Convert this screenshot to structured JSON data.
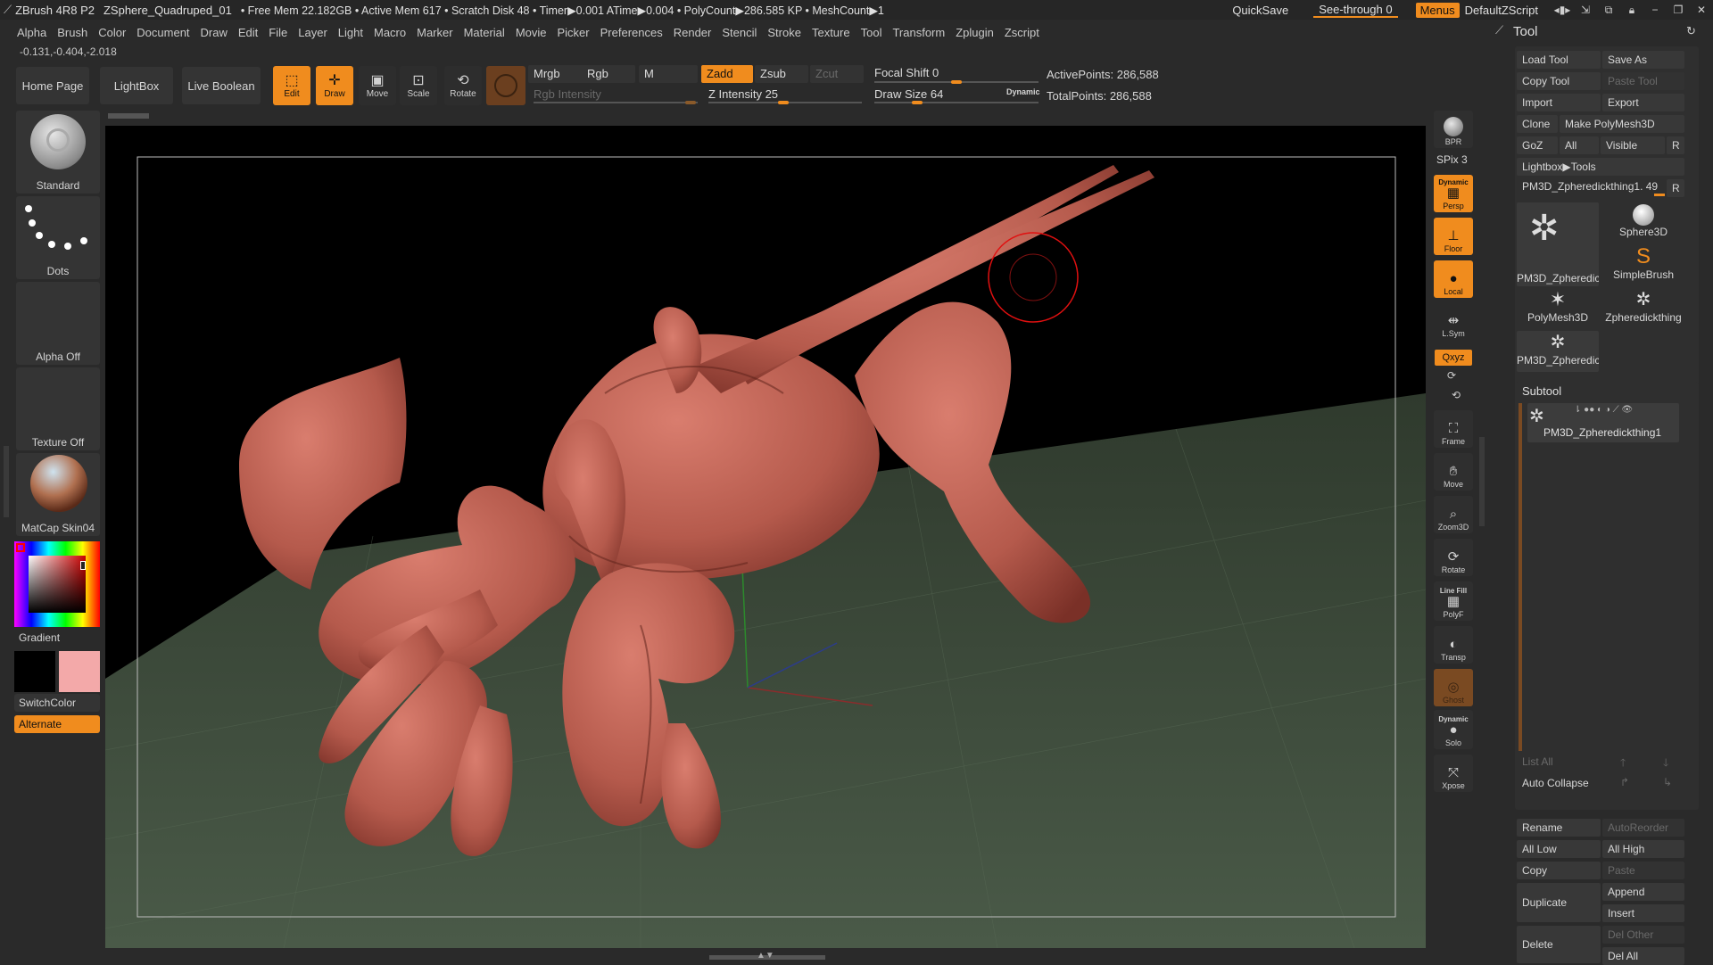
{
  "titlebar": {
    "app": "ZBrush 4R8 P2",
    "document": "ZSphere_Quadruped_01",
    "status": "• Free Mem 22.182GB • Active Mem 617 • Scratch Disk 48 •  Timer▶0.001 ATime▶0.004 • PolyCount▶286.585 KP  • MeshCount▶1",
    "quicksave": "QuickSave",
    "seethrough": "See-through  0",
    "menus": "Menus",
    "script": "DefaultZScript"
  },
  "menubar": [
    "Alpha",
    "Brush",
    "Color",
    "Document",
    "Draw",
    "Edit",
    "File",
    "Layer",
    "Light",
    "Macro",
    "Marker",
    "Material",
    "Movie",
    "Picker",
    "Preferences",
    "Render",
    "Stencil",
    "Stroke",
    "Texture",
    "Tool",
    "Transform",
    "Zplugin",
    "Zscript"
  ],
  "coords": "-0.131,-0.404,-2.018",
  "shelf": {
    "home": "Home Page",
    "lightbox": "LightBox",
    "liveboolean": "Live Boolean",
    "edit": "Edit",
    "draw": "Draw",
    "move": "Move",
    "scale": "Scale",
    "rotate": "Rotate",
    "mrgb": "Mrgb",
    "rgb": "Rgb",
    "m": "M",
    "rgb_intensity": "Rgb Intensity",
    "zadd": "Zadd",
    "zsub": "Zsub",
    "zcut": "Zcut",
    "z_intensity": "Z Intensity 25",
    "focal_shift": "Focal Shift 0",
    "draw_size": "Draw Size 64",
    "dynamic": "Dynamic",
    "active_points": "ActivePoints: 286,588",
    "total_points": "TotalPoints: 286,588"
  },
  "left": {
    "brush": "Standard",
    "stroke": "Dots",
    "alpha": "Alpha Off",
    "texture": "Texture Off",
    "material": "MatCap Skin04",
    "gradient": "Gradient",
    "switchcolor": "SwitchColor",
    "alternate": "Alternate"
  },
  "righttools": {
    "bpr": "BPR",
    "spix": "SPix 3",
    "dynamic": "Dynamic",
    "persp": "Persp",
    "floor": "Floor",
    "local": "Local",
    "lsym": "L.Sym",
    "xyz": "Qxyz",
    "frame": "Frame",
    "move": "Move",
    "zoom": "Zoom3D",
    "rotate": "Rotate",
    "linefill": "Line Fill",
    "polyf": "PolyF",
    "transp": "Transp",
    "ghost": "Ghost",
    "dynamic2": "Dynamic",
    "solo": "Solo",
    "xpose": "Xpose"
  },
  "toolpanel": {
    "title": "Tool",
    "load": "Load Tool",
    "saveas": "Save As",
    "copy": "Copy Tool",
    "paste": "Paste Tool",
    "import": "Import",
    "export": "Export",
    "clone": "Clone",
    "makepoly": "Make PolyMesh3D",
    "goz": "GoZ",
    "all": "All",
    "visible": "Visible",
    "r": "R",
    "lightbox": "Lightbox▶Tools",
    "current": "PM3D_Zpheredickthing1. 49",
    "tiles": [
      "PM3D_Zpheredic",
      "Sphere3D",
      "SimpleBrush",
      "PolyMesh3D",
      "Zpheredickthing",
      "PM3D_Zpheredic"
    ],
    "subtool": "Subtool",
    "subtool_item": "PM3D_Zpheredickthing1",
    "listall": "List All",
    "autocollapse": "Auto Collapse",
    "rename": "Rename",
    "autoreorder": "AutoReorder",
    "alllow": "All Low",
    "allhigh": "All High",
    "copy2": "Copy",
    "paste2": "Paste",
    "duplicate": "Duplicate",
    "append": "Append",
    "insert": "Insert",
    "delete": "Delete",
    "delother": "Del Other",
    "delall": "Del All"
  },
  "colors": {
    "accent": "#f08c1e",
    "model": "#b85a4f",
    "floor": "#3d4a3c"
  }
}
